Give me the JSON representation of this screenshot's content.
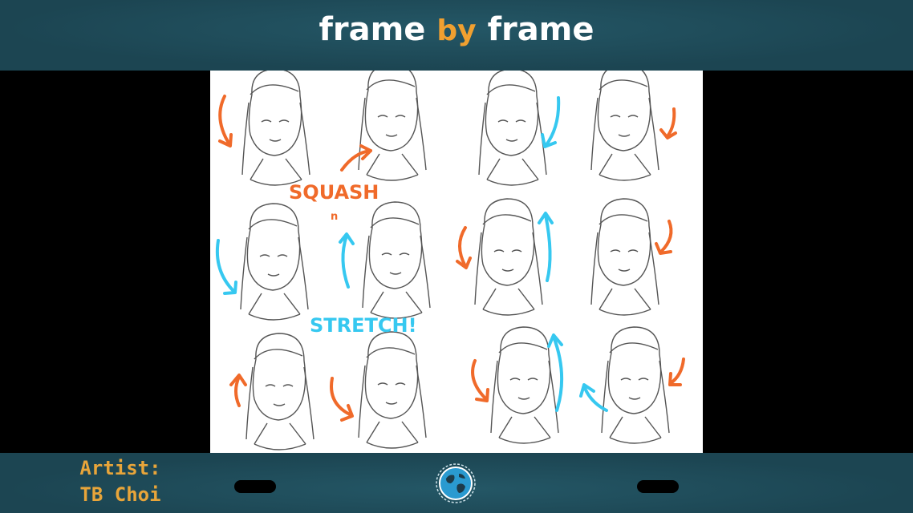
{
  "header": {
    "title_word1": "frame",
    "title_word2": "by",
    "title_word3": "frame"
  },
  "artwork": {
    "label_top": "SQUASH",
    "label_mid": "n",
    "label_bottom": "STRETCH!"
  },
  "footer": {
    "artist_label": "Artist:",
    "artist_name": "TB Choi"
  },
  "icons": {
    "logo": "globe-logo-icon",
    "arrow_warm": "orange-arrow-icon",
    "arrow_cool": "cyan-arrow-icon"
  },
  "colors": {
    "bar": "#1e4c5a",
    "title_accent": "#f0a030",
    "artist_text": "#e8a53a",
    "arrow_orange": "#f06a2a",
    "arrow_cyan": "#36c8f0"
  }
}
